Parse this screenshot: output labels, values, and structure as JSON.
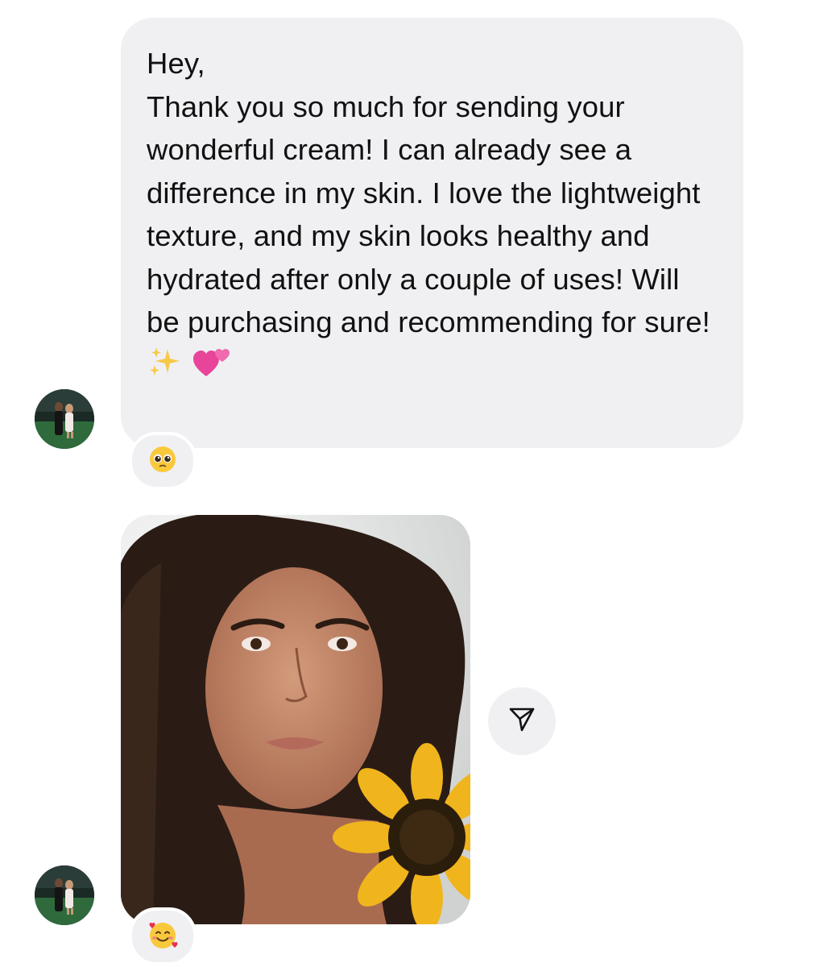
{
  "conversation": {
    "messages": [
      {
        "type": "text",
        "text": "Hey,\nThank you so much for sending your wonderful cream! I can already see a difference in my skin. I love the lightweight texture, and my skin looks healthy and hydrated after only a couple of uses! Will be purchasing and recommending for sure!",
        "trailing_emojis": [
          "sparkles",
          "two-hearts"
        ],
        "reaction": "pleading-face"
      },
      {
        "type": "photo",
        "photo_subject": "selfie-with-sunflower",
        "reaction": "smiling-face-with-hearts"
      }
    ],
    "share_icon": "paper-plane-icon"
  },
  "colors": {
    "bubble": "#f0f0f3",
    "text": "#111111",
    "background": "#ffffff"
  }
}
